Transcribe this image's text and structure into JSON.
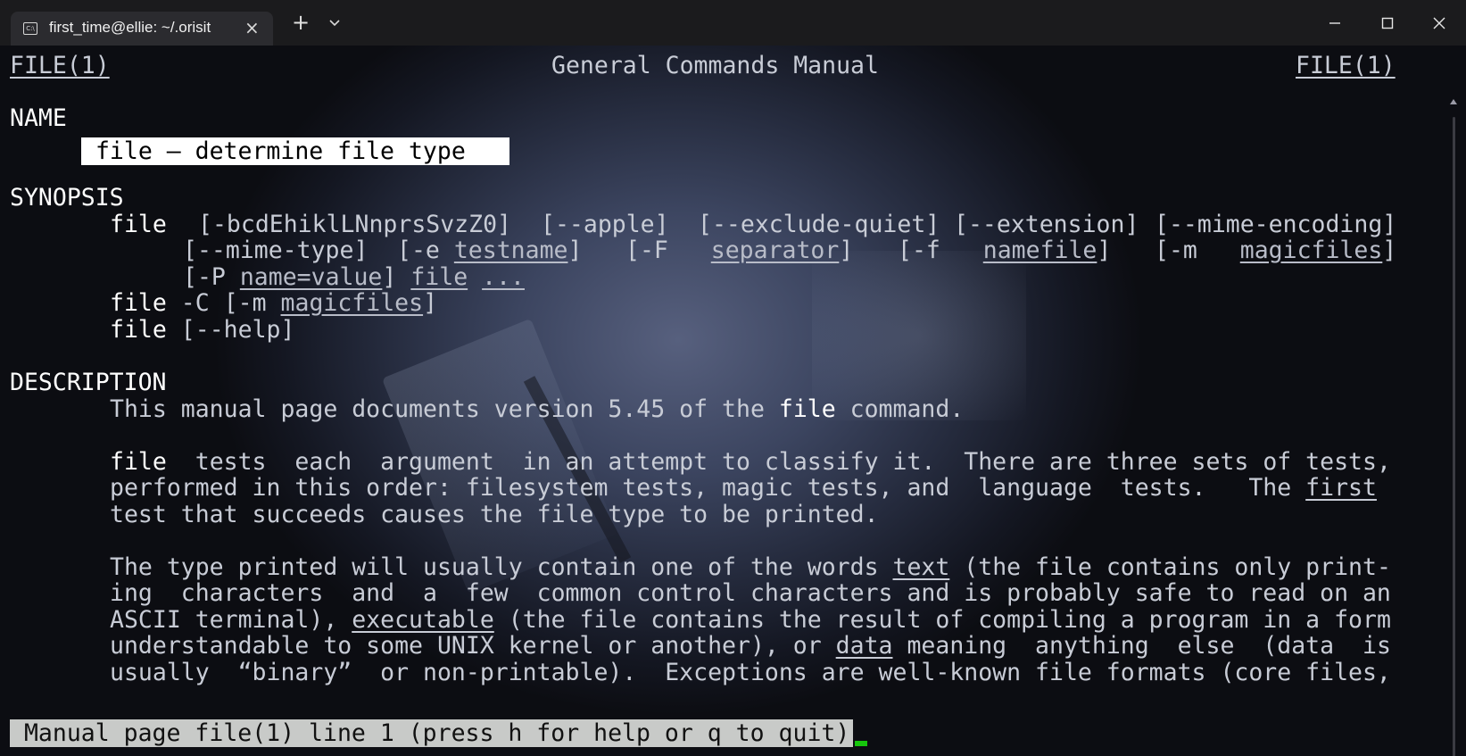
{
  "titlebar": {
    "tab_title": "first_time@ellie: ~/.orisit",
    "tab_icon": "terminal-icon",
    "close_tab": "×",
    "new_tab": "+",
    "icons": [
      "terminal-icon",
      "close-icon",
      "plus-icon",
      "chevron-down-icon",
      "minimize-icon",
      "maximize-icon",
      "close-window-icon"
    ]
  },
  "man": {
    "header_left": "FILE(1)",
    "header_center": "General Commands Manual",
    "header_right": "FILE(1)",
    "section_name": "NAME",
    "name_text": " file — determine file type ",
    "section_synopsis": "SYNOPSIS",
    "syn": {
      "l1_a": "file",
      "l1_b": "[-bcdEhiklLNnprsSvzZ0]",
      "l1_c": "[--apple]",
      "l1_d": "[--exclude-quiet]",
      "l1_e": "[--extension]",
      "l1_f": "[--mime-encoding]",
      "l2_a": "[--mime-type]",
      "l2_b": "[-e",
      "l2_c": "testname",
      "l2_d": "]",
      "l2_e": "[-F",
      "l2_f": "separator",
      "l2_g": "]",
      "l2_h": "[-f",
      "l2_i": "namefile",
      "l2_j": "]",
      "l2_k": "[-m",
      "l2_l": "magicfiles",
      "l2_m": "]",
      "l3_a": "[-P",
      "l3_b": "name=value",
      "l3_c": "]",
      "l3_d": "file",
      "l3_e": "...",
      "l4_a": "file",
      "l4_b": "-C",
      "l4_c": "[-m",
      "l4_d": "magicfiles",
      "l4_e": "]",
      "l5_a": "file",
      "l5_b": "[--help]"
    },
    "section_description": "DESCRIPTION",
    "desc": {
      "p1_a": "This manual page documents version 5.45 of the ",
      "p1_b": "file",
      "p1_c": " command.",
      "p2_l1_a": "file",
      "p2_l1_b": "  tests  each  argument  in an attempt to classify it.  There are three sets of tests,",
      "p2_l2_a": "performed in this order: filesystem tests, magic tests, and  language  tests.   The ",
      "p2_l2_b": "first",
      "p2_l3": "test that succeeds causes the file type to be printed.",
      "p3_l1_a": "The type printed will usually contain one of the words ",
      "p3_l1_b": "text",
      "p3_l1_c": " (the file contains only print-",
      "p3_l2": "ing  characters  and  a  few  common control characters and is probably safe to read on an",
      "p3_l3_a": "ASCII terminal), ",
      "p3_l3_b": "executable",
      "p3_l3_c": " (the file contains the result of compiling a program in a form",
      "p3_l4_a": "understandable to some UNIX kernel or another), or ",
      "p3_l4_b": "data",
      "p3_l4_c": " meaning  anything  else  (data  is",
      "p3_l5": "usually  “binary”  or non-printable).  Exceptions are well-known file formats (core files,"
    },
    "status": " Manual page file(1) line 1 (press h for help or q to quit)"
  },
  "colors": {
    "titlebar": "#1b1b1d",
    "tab": "#2b2b2f",
    "text": "#c8ccd6",
    "bold": "#ffffff",
    "cursor": "#16c60c",
    "status_bg": "#c8cac8"
  }
}
